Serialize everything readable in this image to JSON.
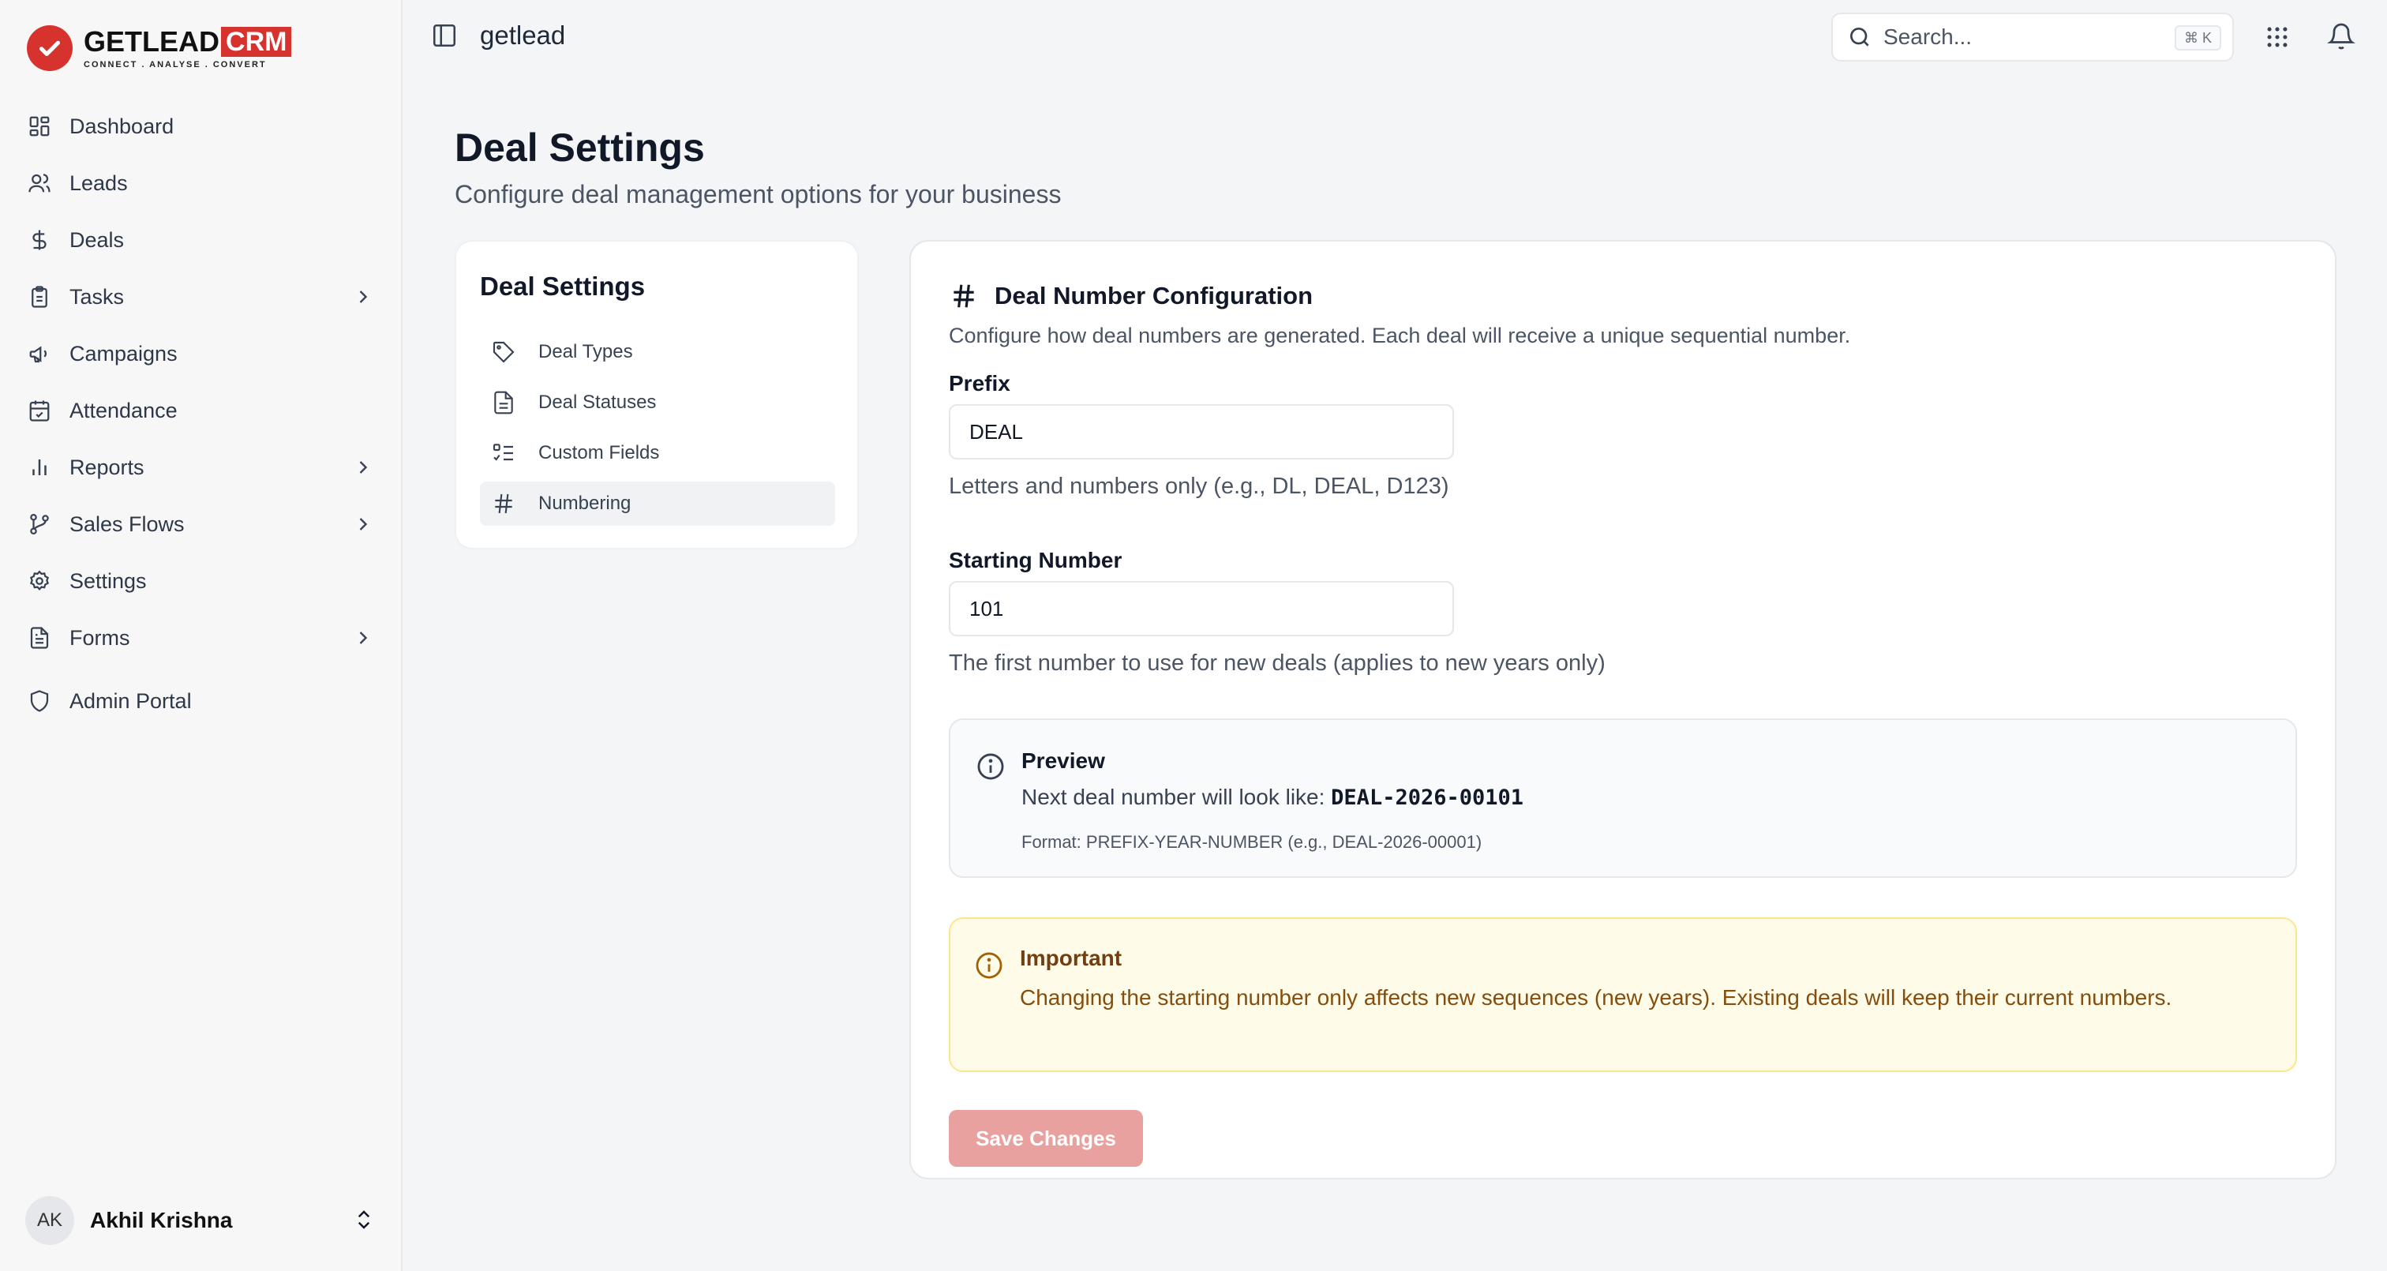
{
  "brand": {
    "name": "GETLEAD",
    "suffix": "CRM",
    "tagline": "CONNECT . ANALYSE . CONVERT"
  },
  "sidebar": {
    "items": [
      {
        "label": "Dashboard",
        "icon": "dashboard-icon",
        "has_children": false
      },
      {
        "label": "Leads",
        "icon": "users-icon",
        "has_children": false
      },
      {
        "label": "Deals",
        "icon": "dollar-icon",
        "has_children": false
      },
      {
        "label": "Tasks",
        "icon": "clipboard-icon",
        "has_children": true
      },
      {
        "label": "Campaigns",
        "icon": "megaphone-icon",
        "has_children": false
      },
      {
        "label": "Attendance",
        "icon": "calendar-check-icon",
        "has_children": false
      },
      {
        "label": "Reports",
        "icon": "bar-chart-icon",
        "has_children": true
      },
      {
        "label": "Sales Flows",
        "icon": "git-branch-icon",
        "has_children": true
      },
      {
        "label": "Settings",
        "icon": "gear-icon",
        "has_children": false
      },
      {
        "label": "Forms",
        "icon": "file-icon",
        "has_children": true
      },
      {
        "label": "Admin Portal",
        "icon": "shield-icon",
        "has_children": false
      }
    ],
    "user": {
      "initials": "AK",
      "name": "Akhil Krishna"
    }
  },
  "topbar": {
    "app_name": "getlead",
    "search_placeholder": "Search...",
    "search_shortcut": "⌘ K"
  },
  "page": {
    "title": "Deal Settings",
    "subtitle": "Configure deal management options for your business"
  },
  "settings_nav": {
    "title": "Deal Settings",
    "items": [
      {
        "label": "Deal Types",
        "icon": "tag-icon",
        "active": false
      },
      {
        "label": "Deal Statuses",
        "icon": "document-icon",
        "active": false
      },
      {
        "label": "Custom Fields",
        "icon": "list-checks-icon",
        "active": false
      },
      {
        "label": "Numbering",
        "icon": "hash-icon",
        "active": true
      }
    ]
  },
  "numbering": {
    "title": "Deal Number Configuration",
    "description": "Configure how deal numbers are generated. Each deal will receive a unique sequential number.",
    "prefix": {
      "label": "Prefix",
      "value": "DEAL",
      "hint": "Letters and numbers only (e.g., DL, DEAL, D123)"
    },
    "starting_number": {
      "label": "Starting Number",
      "value": "101",
      "hint": "The first number to use for new deals (applies to new years only)"
    },
    "preview": {
      "title": "Preview",
      "line_prefix": "Next deal number will look like: ",
      "example": "DEAL-2026-00101",
      "format": "Format: PREFIX-YEAR-NUMBER (e.g., DEAL-2026-00001)"
    },
    "important": {
      "title": "Important",
      "text": "Changing the starting number only affects new sequences (new years). Existing deals will keep their current numbers."
    },
    "save_label": "Save Changes"
  },
  "colors": {
    "accent": "#d6322e",
    "save_button_disabled": "#e8a19f",
    "warning_bg": "#fefce8",
    "warning_border": "#fde68a"
  }
}
